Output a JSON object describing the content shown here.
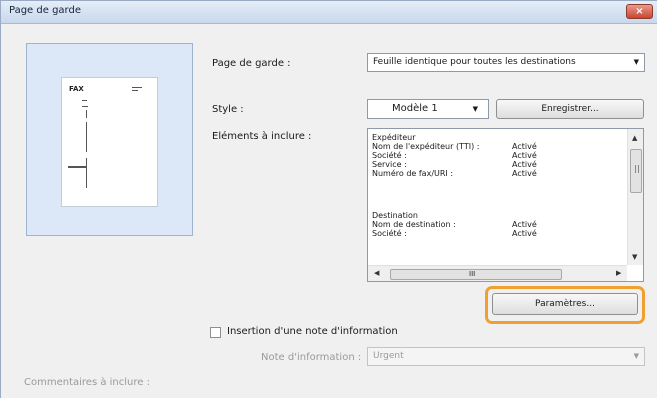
{
  "window": {
    "title": "Page de garde",
    "close_glyph": "×"
  },
  "preview": {
    "fax_label": "FAX"
  },
  "cover_page": {
    "label": "Page de garde :",
    "value": "Feuille identique pour toutes les destinations"
  },
  "style": {
    "label": "Style :",
    "value": "Modèle 1",
    "save_button": "Enregistrer..."
  },
  "elements": {
    "label": "Eléments à inclure :",
    "lines": [
      {
        "text": "Expéditeur",
        "value": ""
      },
      {
        "text": "Nom de l'expéditeur (TTI) :",
        "value": "Activé"
      },
      {
        "text": "Société :",
        "value": "Activé"
      },
      {
        "text": "Service :",
        "value": "Activé"
      },
      {
        "text": "Numéro de fax/URI :",
        "value": "Activé"
      },
      {
        "text": "",
        "value": ""
      },
      {
        "text": "Destination",
        "value": ""
      },
      {
        "text": "Nom de destination :",
        "value": "Activé"
      },
      {
        "text": "Société :",
        "value": "Activé"
      }
    ],
    "h_thumb_label": "III"
  },
  "params_button": "Paramètres...",
  "insert_note": {
    "label": "Insertion d'une note d'information",
    "checked": false
  },
  "note_info": {
    "label": "Note d'information :",
    "value": "Urgent"
  },
  "comments": {
    "label": "Commentaires à inclure :"
  }
}
